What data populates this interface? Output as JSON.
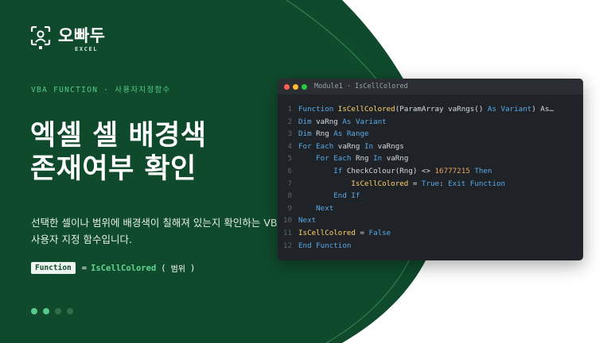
{
  "colors": {
    "green_bg": "#0f4a2c",
    "accent": "#58c98a",
    "editor_bg": "#1f2327"
  },
  "brand": {
    "name": "오빠두",
    "sub": "EXCEL",
    "icon": "camera-person-icon"
  },
  "eyebrow": "VBA FUNCTION · 사용자지정함수",
  "title": {
    "line1": "엑셀 셀 배경색",
    "line2": "존재여부 확인"
  },
  "description": "선택한 셀이나 범위에 배경색이 칠해져 있는지 확인하는 VBA 사용자 지정 함수입니다.",
  "syntax": {
    "badge": "Function",
    "eq": "=",
    "name": "IsCellColored",
    "open": "(",
    "arg": "범위",
    "close": ")"
  },
  "pager": {
    "count": 4,
    "active": [
      0,
      1
    ]
  },
  "editor": {
    "window_title": "Module1 · IsCellColored",
    "lines": [
      {
        "no": "1",
        "tokens": [
          [
            "kw",
            "Function "
          ],
          [
            "fn",
            "IsCellColored"
          ],
          [
            "plain",
            "(ParamArray vaRngs() "
          ],
          [
            "kw",
            "As Variant"
          ],
          [
            "plain",
            ") As…"
          ]
        ]
      },
      {
        "no": "2",
        "tokens": [
          [
            "kw",
            "Dim "
          ],
          [
            "plain",
            "vaRng "
          ],
          [
            "kw",
            "As Variant"
          ]
        ]
      },
      {
        "no": "3",
        "tokens": [
          [
            "kw",
            "Dim "
          ],
          [
            "plain",
            "Rng "
          ],
          [
            "kw",
            "As Range"
          ]
        ]
      },
      {
        "no": "4",
        "tokens": [
          [
            "kw",
            "For Each "
          ],
          [
            "plain",
            "vaRng "
          ],
          [
            "kw",
            "In "
          ],
          [
            "plain",
            "vaRngs"
          ]
        ]
      },
      {
        "no": "5",
        "tokens": [
          [
            "plain",
            "    "
          ],
          [
            "kw",
            "For Each "
          ],
          [
            "plain",
            "Rng "
          ],
          [
            "kw",
            "In "
          ],
          [
            "plain",
            "vaRng"
          ]
        ]
      },
      {
        "no": "6",
        "tokens": [
          [
            "plain",
            "        "
          ],
          [
            "kw",
            "If "
          ],
          [
            "plain",
            "CheckColour(Rng) <> "
          ],
          [
            "num",
            "16777215"
          ],
          [
            "kw",
            " Then"
          ]
        ]
      },
      {
        "no": "7",
        "tokens": [
          [
            "plain",
            "            "
          ],
          [
            "fn",
            "IsCellColored"
          ],
          [
            "plain",
            " = "
          ],
          [
            "kw",
            "True"
          ],
          [
            "plain",
            ": "
          ],
          [
            "kw",
            "Exit Function"
          ]
        ]
      },
      {
        "no": "8",
        "tokens": [
          [
            "plain",
            "        "
          ],
          [
            "kw",
            "End If"
          ]
        ]
      },
      {
        "no": "9",
        "tokens": [
          [
            "plain",
            "    "
          ],
          [
            "kw",
            "Next"
          ]
        ]
      },
      {
        "no": "10",
        "tokens": [
          [
            "kw",
            "Next"
          ]
        ]
      },
      {
        "no": "11",
        "tokens": [
          [
            "fn",
            "IsCellColored"
          ],
          [
            "plain",
            " = "
          ],
          [
            "kw",
            "False"
          ]
        ]
      },
      {
        "no": "12",
        "tokens": [
          [
            "kw",
            "End Function"
          ]
        ]
      }
    ]
  }
}
